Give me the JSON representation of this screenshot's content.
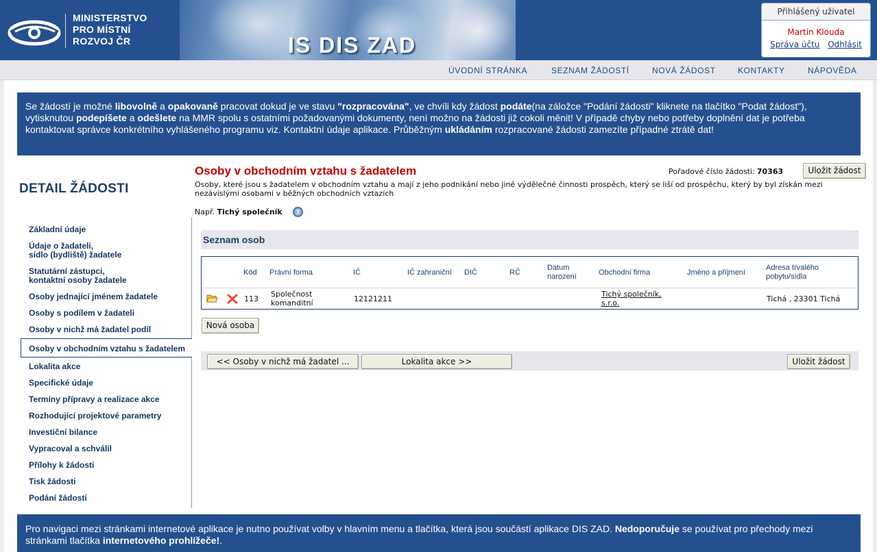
{
  "header": {
    "ministry_lines": [
      "MINISTERSTVO",
      "PRO MÍSTNÍ",
      "ROZVOJ ČR"
    ],
    "app_title": "IS DIS ZAD"
  },
  "user": {
    "box_title": "Přihlášený uživatel",
    "name": "Martin Klouda",
    "account_link": "Správa účtu",
    "logout_link": "Odhlásit"
  },
  "topnav": {
    "items": [
      "ÚVODNÍ STRÁNKA",
      "SEZNAM ŽÁDOSTÍ",
      "NOVÁ ŽÁDOST",
      "KONTAKTY",
      "NÁPOVĚDA"
    ]
  },
  "info_top": {
    "p1": "Se žádostí je možné ",
    "b1": "libovolně",
    "p2": " a ",
    "b2": "opakovaně",
    "p3": " pracovat dokud je ve stavu ",
    "b3": "\"rozpracována\"",
    "p4": ", ve chvíli kdy žádost ",
    "b4": "podáte",
    "p5": "(na záložce \"Podání žádosti\" kliknete na tlačítko \"Podat žádost\"), vytisknutou ",
    "b5": "podepíšete",
    "p6": " a ",
    "b6": "odešlete",
    "p7": " na MMR spolu s ostatními požadovanými dokumenty, není možno na žádosti již cokoli měnit! V případě chyby nebo potřeby doplnění dat je potřeba kontaktovat správce konkrétního vyhlášeného programu viz. Kontaktní údaje aplikace. Průběžným ",
    "b7": "ukládáním",
    "p8": " rozpracované žádosti zamezíte případné ztrátě dat!"
  },
  "sidebar": {
    "title": "DETAIL ŽÁDOSTI",
    "items": [
      {
        "line1": "Základní údaje",
        "line2": ""
      },
      {
        "line1": "Údaje o žadateli,",
        "line2": "sídlo (bydliště) žadatele"
      },
      {
        "line1": "Statutární zástupci,",
        "line2": "kontaktní osoby žadatele"
      },
      {
        "line1": "Osoby jednající jménem žadatele",
        "line2": ""
      },
      {
        "line1": "Osoby s podílem v žadateli",
        "line2": ""
      },
      {
        "line1": "Osoby v nichž má žadatel podíl",
        "line2": ""
      },
      {
        "line1": "Osoby v obchodním vztahu s žadatelem",
        "line2": ""
      },
      {
        "line1": "Lokalita akce",
        "line2": ""
      },
      {
        "line1": "Specifické údaje",
        "line2": ""
      },
      {
        "line1": "Termíny přípravy a realizace akce",
        "line2": ""
      },
      {
        "line1": "Rozhodující projektové parametry",
        "line2": ""
      },
      {
        "line1": "Investiční bilance",
        "line2": ""
      },
      {
        "line1": "Vypracoval a schválil",
        "line2": ""
      },
      {
        "line1": "Přílohy k žádosti",
        "line2": ""
      },
      {
        "line1": "Tisk žádosti",
        "line2": ""
      },
      {
        "line1": "Podání žádosti",
        "line2": ""
      }
    ],
    "active_index": 6
  },
  "main": {
    "title": "Osoby v obchodním vztahu s žadatelem",
    "order_label": "Pořadové číslo žádosti:",
    "order_number": "70363",
    "save_label": "Uložit žádost",
    "description": "Osoby, které jsou s žadatelem v obchodním vztahu a mají z jeho podnikání nebo jiné výdělečné činnosti prospěch, který se liší od prospěchu, který by byl získán mezi nezávislými osobami v běžných obchodních vztazích",
    "example_prefix": "Např.",
    "example_value": "Tichý společník",
    "list_title": "Seznam osob",
    "table": {
      "columns": [
        "Kód",
        "Právní forma",
        "IČ",
        "IČ zahraniční",
        "DIČ",
        "RČ",
        "Datum narození",
        "Obchodní firma",
        "Jméno a příjmení",
        "Adresa trvalého pobytu/sídla"
      ],
      "rows": [
        {
          "kod": "113",
          "pravni_forma": "Společnost komanditní",
          "ic": "12121211",
          "ic_zahranicni": "",
          "dic": "",
          "rc": "",
          "datum_narozeni": "",
          "obchodni_firma": "Tichý společník, s.r.o.",
          "jmeno": "",
          "adresa": "Tichá , 23301 Tichá"
        }
      ]
    },
    "new_person_label": "Nová osoba",
    "prev_label": "<<  Osoby v nichž má žadatel ...",
    "next_label": "Lokalita akce  >>"
  },
  "info_bottom": {
    "p1": "Pro navigaci mezi stránkami internetové aplikace je nutno používat volby v hlavním menu a tlačítka, která jsou součástí aplikace DIS ZAD. ",
    "b1": "Nedoporučuje",
    "p2": " se používat pro přechody mezi stránkami tlačítka ",
    "b2": "internetového prohlížeče!",
    "p3": "."
  },
  "colors": {
    "brand_blue": "#25508f",
    "title_red": "#c00000",
    "nav_text": "#1d4a82"
  }
}
